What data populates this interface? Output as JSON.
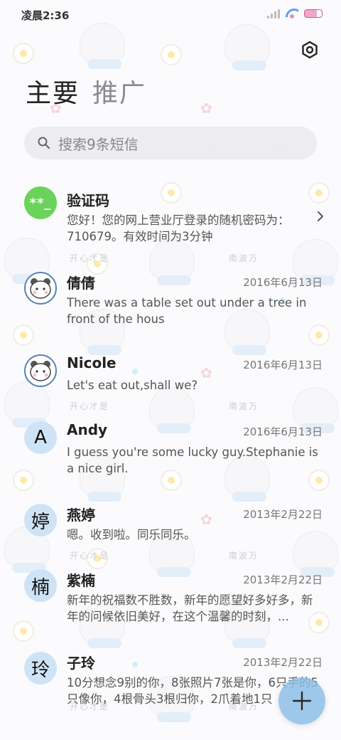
{
  "status_bar": {
    "time": "凌晨2:36",
    "icons": [
      "signal-icon",
      "wifi-icon",
      "battery-icon"
    ]
  },
  "header": {
    "settings_icon": "gear-icon"
  },
  "tabs": [
    {
      "label": "主要",
      "active": true
    },
    {
      "label": "推广",
      "active": false
    }
  ],
  "search": {
    "placeholder": "搜索9条短信"
  },
  "conversations": [
    {
      "name": "验证码",
      "avatar_text": "**_",
      "date": "",
      "preview": "您好！您的网上营业厅登录的随机密码为：710679。有效时间为3分钟"
    },
    {
      "name": "倩倩",
      "avatar_text": "",
      "date": "2016年6月13日",
      "preview": "There was a table set out under a tree in front of the hous"
    },
    {
      "name": "Nicole",
      "avatar_text": "",
      "date": "2016年6月13日",
      "preview": "Let's eat out,shall we?"
    },
    {
      "name": "Andy",
      "avatar_text": "A",
      "date": "2016年6月13日",
      "preview": "I guess you're some lucky guy.Stephanie is a nice girl."
    },
    {
      "name": "燕婷",
      "avatar_text": "婷",
      "date": "2013年2月22日",
      "preview": "嗯。收到啦。同乐同乐。"
    },
    {
      "name": "紫楠",
      "avatar_text": "楠",
      "date": "2013年2月22日",
      "preview": "新年的祝福数不胜数，新年的愿望好多好多，新年的问候依旧美好，在这个温馨的时刻，..."
    },
    {
      "name": "子玲",
      "avatar_text": "玲",
      "date": "2013年2月22日",
      "preview": "10分想念9别的你，8张照片7张是你，6只手的5只像你，4根骨头3根归你，2爪着地1只"
    }
  ],
  "watermarks": [
    "开心才是",
    "南波万"
  ],
  "fab": {
    "icon": "plus-icon"
  },
  "colors": {
    "accent": "#8cbee6",
    "code_avatar": "#6bd35b",
    "letter_avatar": "#cfe3f6"
  }
}
